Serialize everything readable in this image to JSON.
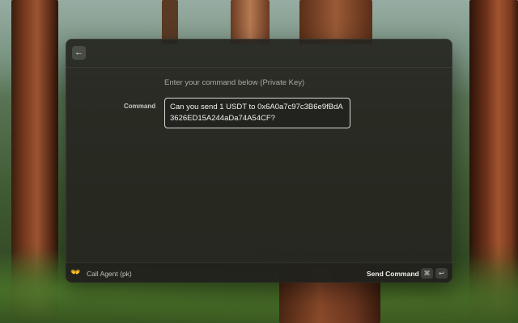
{
  "hint": "Enter your command below (Private Key)",
  "command": {
    "label": "Command",
    "value": "Can you send 1 USDT to 0x6A0a7c97c3B6e9fBdA3626ED15A244aDa74A54CF?"
  },
  "icons": {
    "back": "arrow-left-icon",
    "agent": "agent-icon",
    "cmd_key": "command-key-icon",
    "return_key": "return-key-icon"
  },
  "footer": {
    "agent_label": "Call Agent (pk)",
    "send_label": "Send Command",
    "cmd_glyph": "⌘",
    "return_glyph": "↩"
  },
  "glyphs": {
    "back": "←",
    "agent": "👐"
  }
}
